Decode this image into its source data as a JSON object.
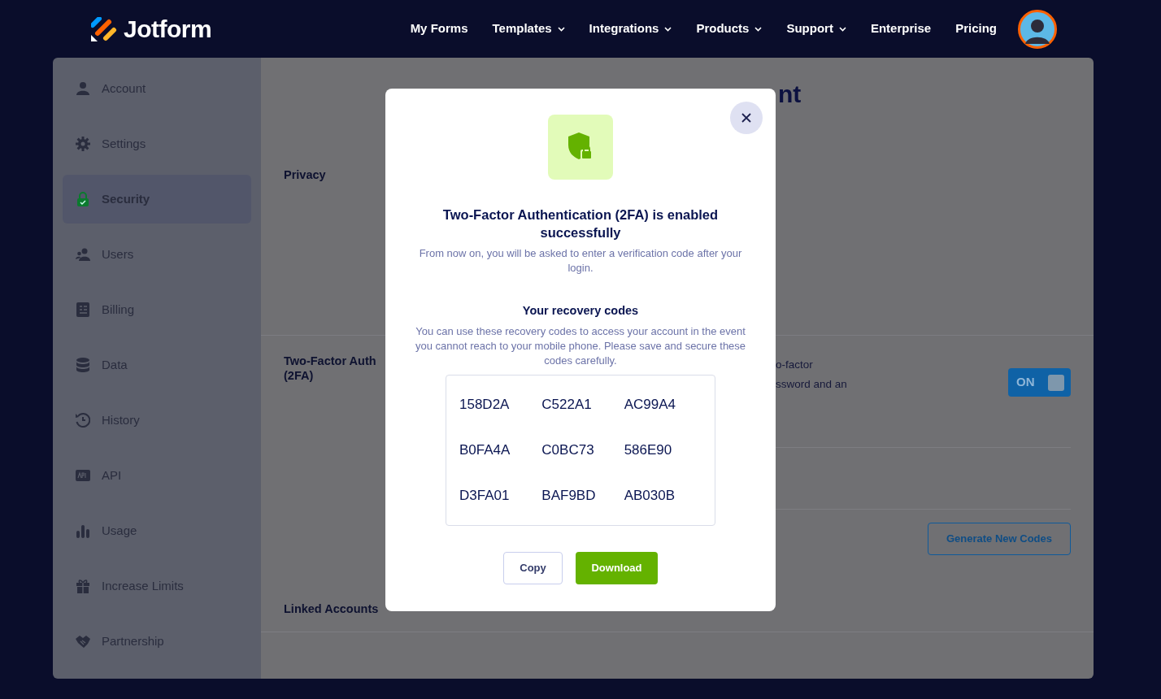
{
  "nav": {
    "brand": "Jotform",
    "links": [
      {
        "label": "My Forms",
        "dropdown": false
      },
      {
        "label": "Templates",
        "dropdown": true
      },
      {
        "label": "Integrations",
        "dropdown": true
      },
      {
        "label": "Products",
        "dropdown": true
      },
      {
        "label": "Support",
        "dropdown": true
      },
      {
        "label": "Enterprise",
        "dropdown": false
      },
      {
        "label": "Pricing",
        "dropdown": false
      }
    ]
  },
  "sidebar": {
    "items": [
      {
        "label": "Account",
        "kind": "person",
        "selected": false
      },
      {
        "label": "Settings",
        "kind": "gear",
        "selected": false
      },
      {
        "label": "Security",
        "kind": "lock",
        "selected": true
      },
      {
        "label": "Users",
        "kind": "users",
        "selected": false
      },
      {
        "label": "Billing",
        "kind": "billing",
        "selected": false
      },
      {
        "label": "Data",
        "kind": "database",
        "selected": false
      },
      {
        "label": "History",
        "kind": "history",
        "selected": false
      },
      {
        "label": "API",
        "kind": "api",
        "selected": false
      },
      {
        "label": "Usage",
        "kind": "bars",
        "selected": false
      },
      {
        "label": "Increase Limits",
        "kind": "gift",
        "selected": false
      },
      {
        "label": "Partnership",
        "kind": "handshake",
        "selected": false
      }
    ]
  },
  "content": {
    "heading_fragment": "nt",
    "privacy_label": "Privacy",
    "twofa": {
      "label_lines": [
        "Two-Factor Auth",
        "(2FA)"
      ],
      "description_lines": [
        "o-factor",
        "ssword and an"
      ],
      "toggle": {
        "label": "ON",
        "on": true
      }
    },
    "generate_button": "Generate New Codes",
    "linked_accounts_label": "Linked Accounts"
  },
  "modal": {
    "title": "Two-Factor Authentication (2FA) is enabled successfully",
    "subtitle": "From now on, you will be asked to enter a verification code after your login.",
    "codes_heading": "Your recovery codes",
    "codes_description": "You can use these recovery codes to access your account in the event you cannot reach to your mobile phone. Please save and secure these codes carefully.",
    "codes": [
      "158D2A",
      "C522A1",
      "AC99A4",
      "B0FA4A",
      "C0BC73",
      "586E90",
      "D3FA01",
      "BAF9BD",
      "AB030B"
    ],
    "buttons": [
      {
        "label": "Copy",
        "kind": "secondary"
      },
      {
        "label": "Download",
        "kind": "primary"
      }
    ]
  }
}
